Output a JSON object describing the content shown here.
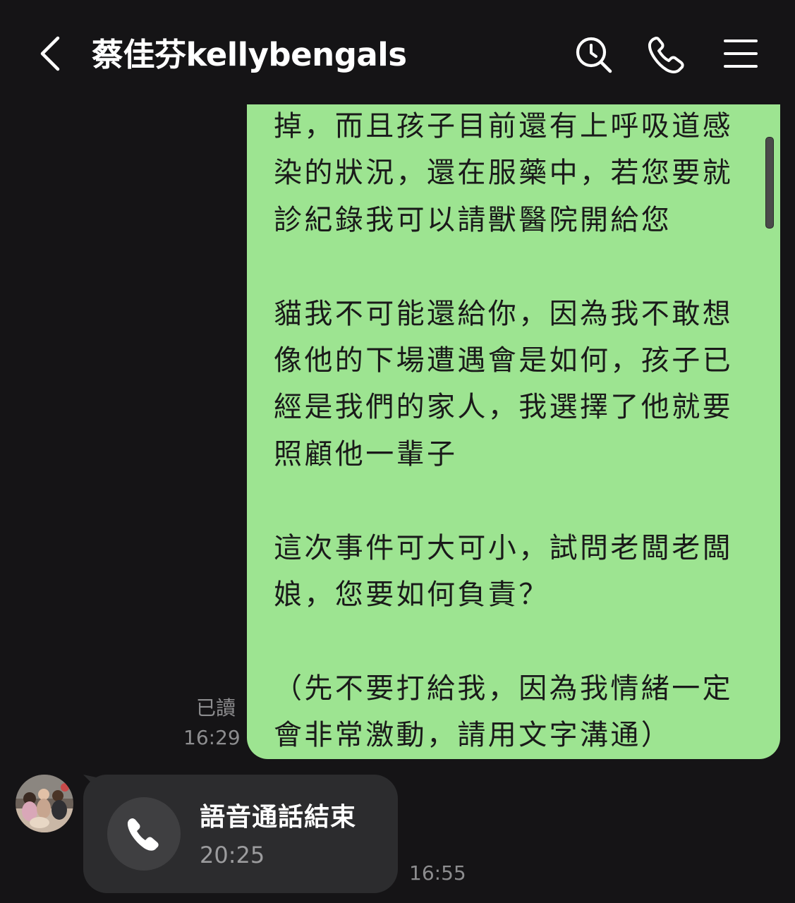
{
  "header": {
    "title": "蔡佳芬kellybengals",
    "back_icon": "chevron-left-icon",
    "search_icon": "search-icon",
    "call_icon": "phone-icon",
    "menu_icon": "menu-icon"
  },
  "messages": {
    "outgoing": {
      "text": "掉，而且孩子目前還有上呼吸道感\n染的狀況，還在服藥中，若您要就\n診紀錄我可以請獸醫院開給您\n\n貓我不可能還給你，因為我不敢想\n像他的下場遭遇會是如何，孩子已\n經是我們的家人，我選擇了他就要\n照顧他一輩子\n\n這次事件可大可小，試問老闆老闆\n娘，您要如何負責？\n\n（先不要打給我，因為我情緒一定\n會非常激動，請用文字溝通）",
      "read_label": "已讀",
      "time": "16:29",
      "bubble_color": "#9de491"
    },
    "incoming_call": {
      "title": "語音通話結束",
      "duration": "20:25",
      "time": "16:55",
      "icon": "phone-icon"
    }
  },
  "colors": {
    "background": "#151416",
    "incoming_bubble": "#2c2c2e",
    "timestamp": "#8d8d8f"
  }
}
